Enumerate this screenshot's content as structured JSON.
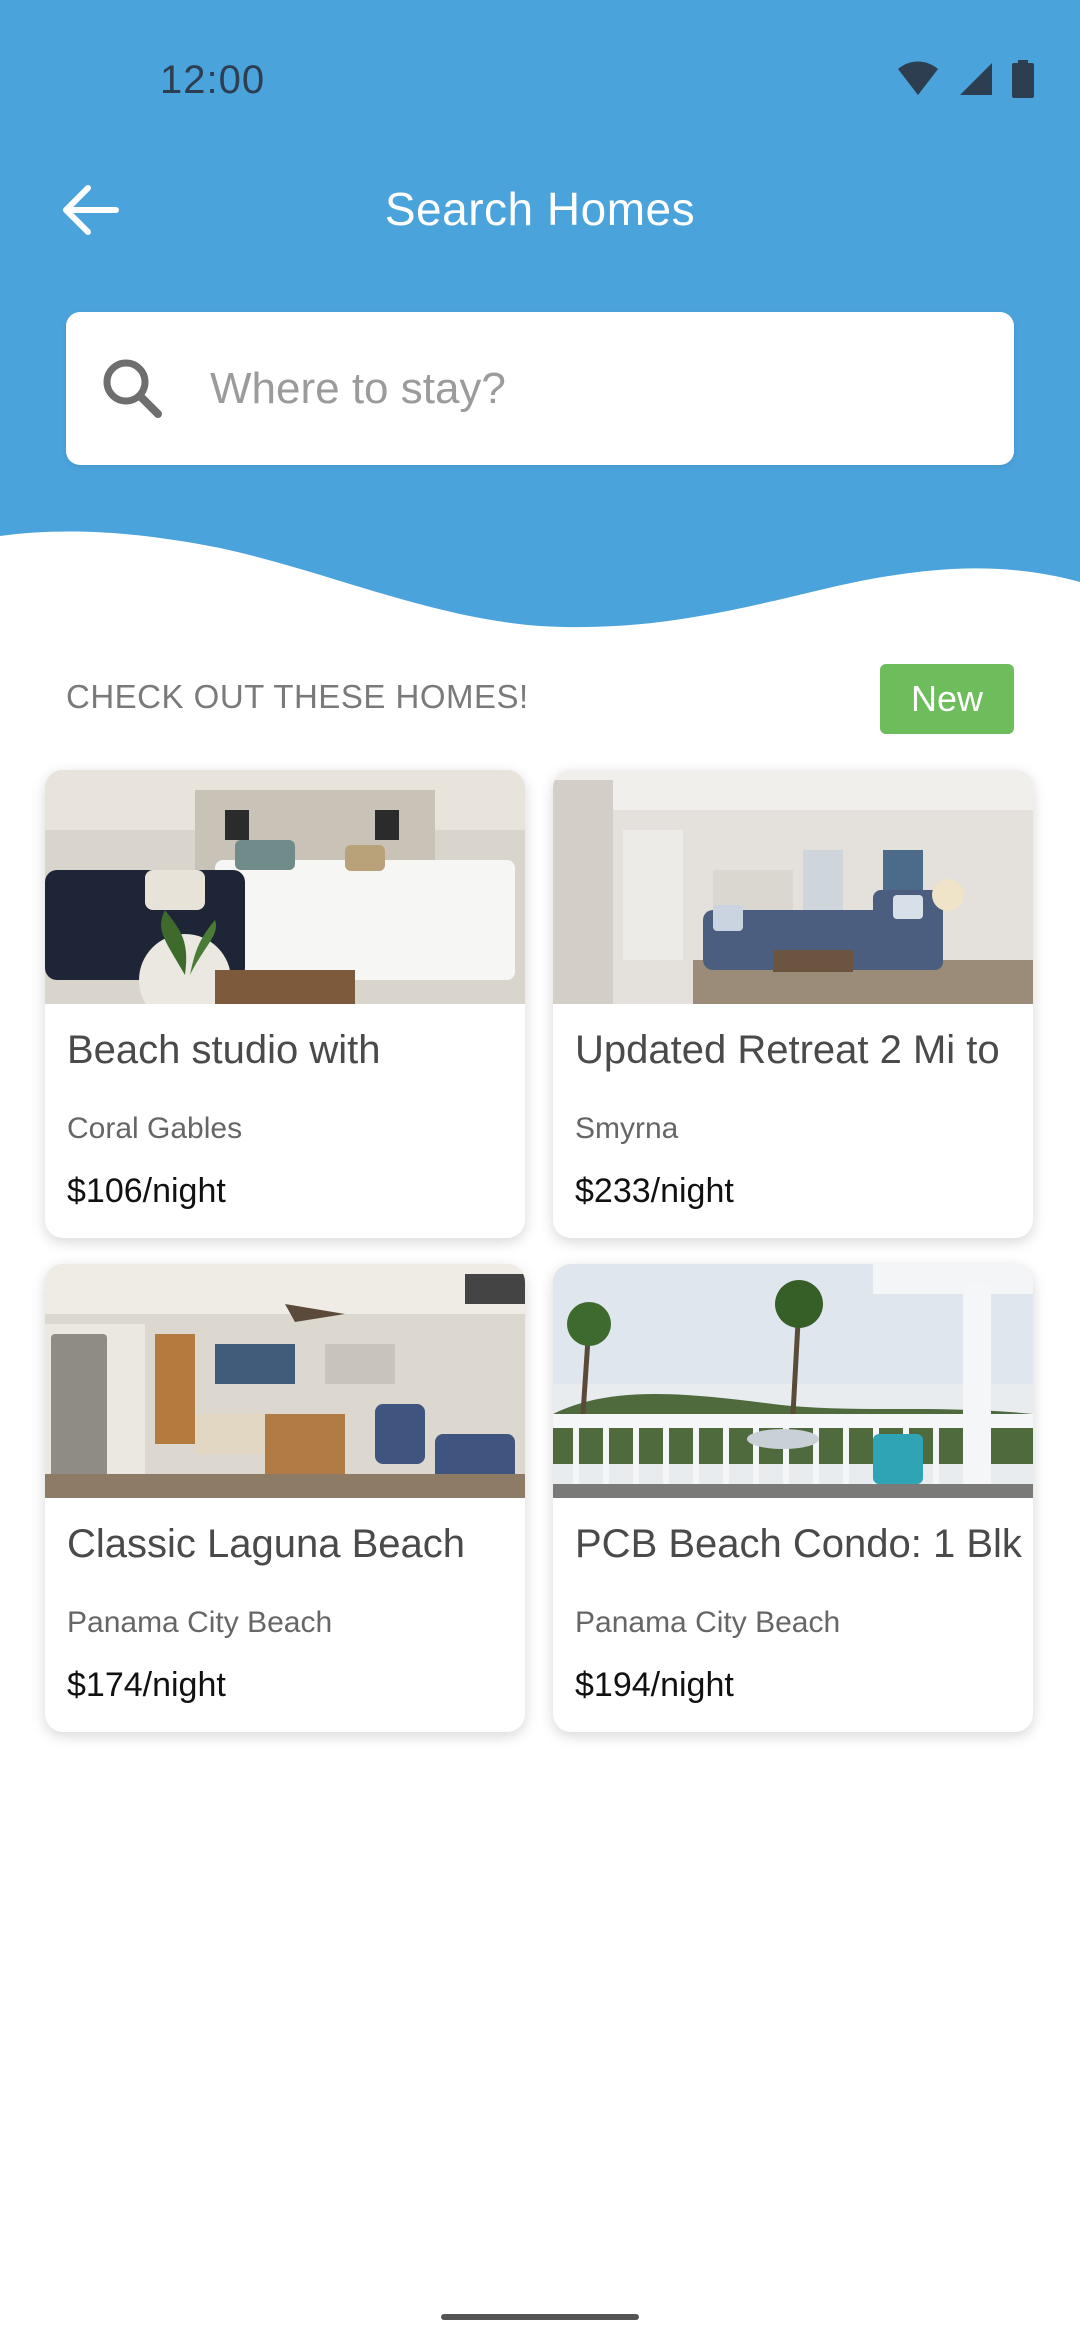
{
  "colors": {
    "header_blue": "#4ba3dc",
    "badge_green": "#6dbd5c",
    "white": "#ffffff"
  },
  "status_bar": {
    "time": "12:00",
    "icons": [
      "wifi-icon",
      "signal-icon",
      "battery-icon"
    ]
  },
  "header": {
    "back_icon": "arrow-left-icon",
    "title": "Search Homes"
  },
  "search": {
    "icon": "search-icon",
    "placeholder": "Where to stay?",
    "value": ""
  },
  "section": {
    "heading": "CHECK OUT THESE HOMES!",
    "badge": "New"
  },
  "listings": [
    {
      "title": "Beach studio with",
      "location": "Coral Gables",
      "price": "$106/night",
      "image": "bedroom-photo"
    },
    {
      "title": "Updated Retreat 2 Mi to",
      "location": "Smyrna",
      "price": "$233/night",
      "image": "living-room-photo"
    },
    {
      "title": "Classic Laguna Beach",
      "location": "Panama City Beach",
      "price": "$174/night",
      "image": "kitchen-dining-photo"
    },
    {
      "title": "PCB Beach Condo: 1 Blk",
      "location": "Panama City Beach",
      "price": "$194/night",
      "image": "balcony-view-photo"
    }
  ]
}
